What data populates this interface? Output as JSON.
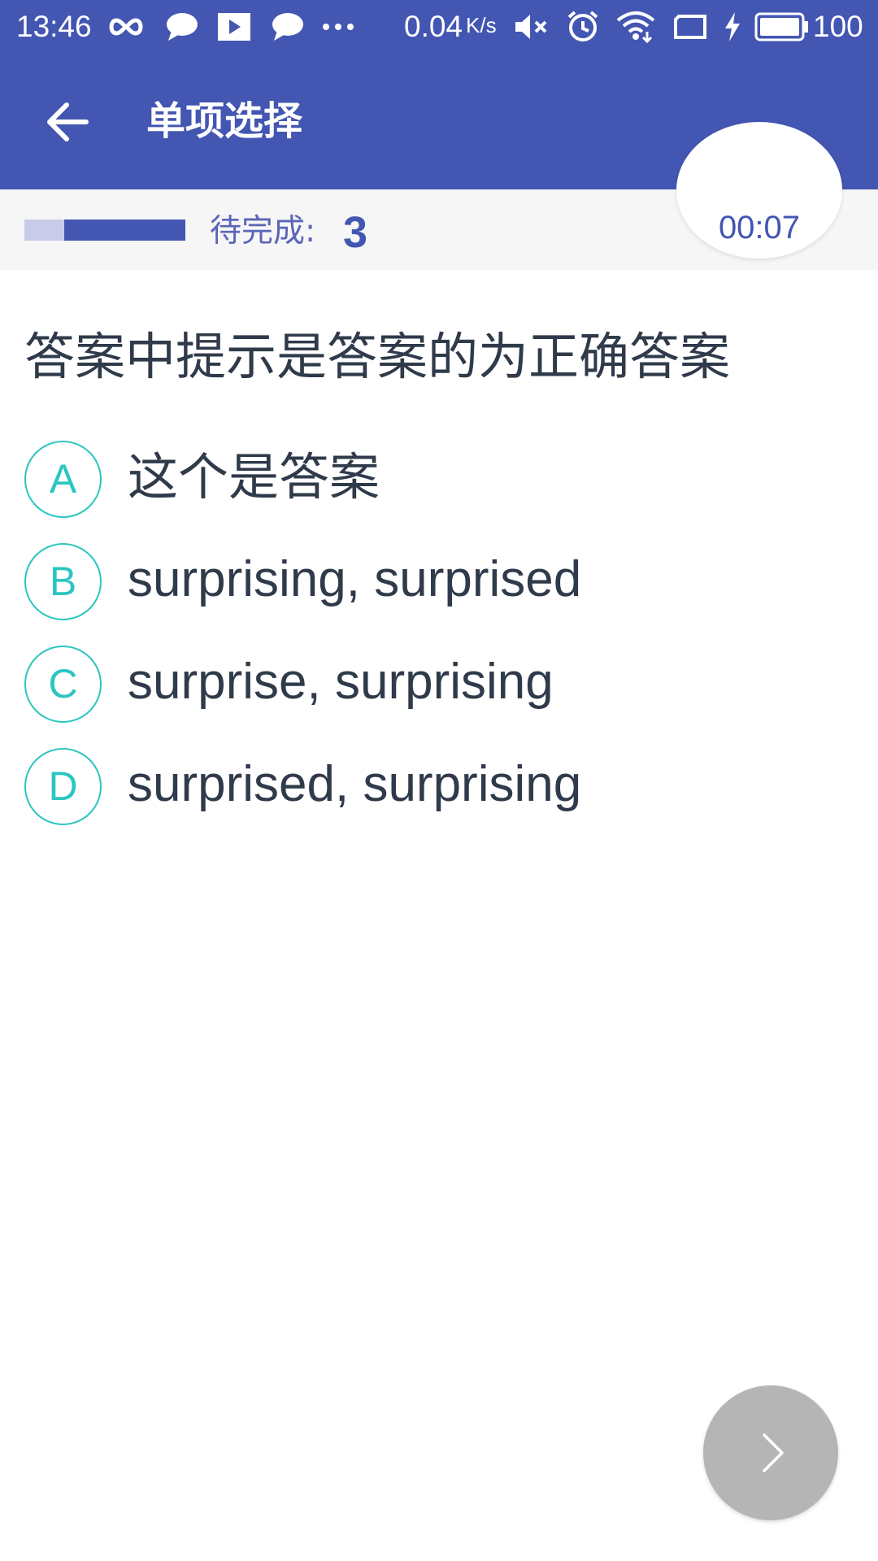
{
  "status_bar": {
    "time": "13:46",
    "network_speed": "0.04",
    "network_unit": "K/s",
    "battery": "100",
    "icons": [
      "infinity-icon",
      "chat-bubble-icon",
      "play-icon",
      "chat-bubble-icon",
      "more-dots-icon",
      "mute-icon",
      "alarm-icon",
      "wifi-icon",
      "screen-icon",
      "charging-icon",
      "battery-icon"
    ]
  },
  "app_bar": {
    "title": "单项选择",
    "back_icon": "arrow-left-icon"
  },
  "progress": {
    "completed_fraction": 0.25,
    "pending_label": "待完成:",
    "pending_count": "3",
    "timer": "00:07"
  },
  "question": {
    "text": "答案中提示是答案的为正确答案",
    "options": [
      {
        "letter": "A",
        "text": "这个是答案"
      },
      {
        "letter": "B",
        "text": "surprising, surprised"
      },
      {
        "letter": "C",
        "text": "surprise, surprising"
      },
      {
        "letter": "D",
        "text": "surprised, surprising"
      }
    ]
  },
  "next_button": {
    "icon": "chevron-right-icon"
  },
  "colors": {
    "primary": "#4356b2",
    "accent": "#2bc6c0",
    "text": "#2f3a4a",
    "fab": "#b5b5b5"
  }
}
